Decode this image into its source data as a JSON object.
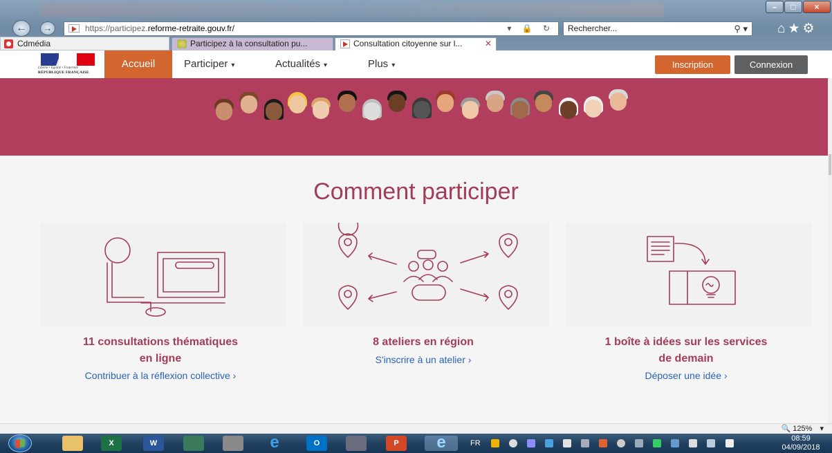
{
  "browser": {
    "url_scheme": "https://",
    "url_sub": "participez.",
    "url_domain": "reforme-retraite.gouv.fr",
    "url_path": "/",
    "search_placeholder": "Rechercher...",
    "favorites_label": "Cdmédia",
    "tabs": [
      {
        "label": "Participez à la consultation pu...",
        "active": false
      },
      {
        "label": "Consultation citoyenne sur l...",
        "active": true
      }
    ],
    "status_zoom": "🔍 125%",
    "zoom_caret": "▾"
  },
  "site": {
    "logo": {
      "devise": "Liberté • Égalité • Fraternité",
      "name": "RÉPUBLIQUE FRANÇAISE"
    },
    "nav": [
      {
        "label": "Accueil",
        "active": true
      },
      {
        "label": "Participer",
        "dropdown": true
      },
      {
        "label": "Actualités",
        "dropdown": true
      },
      {
        "label": "Plus",
        "dropdown": true
      }
    ],
    "btn_inscription": "Inscription",
    "btn_connexion": "Connexion",
    "accent": "#d3652e",
    "brand": "#b03e5c"
  },
  "main": {
    "title": "Comment participer",
    "columns": [
      {
        "title_line1": "11 consultations thématiques",
        "title_line2": "en ligne",
        "link": "Contribuer à la réflexion collective ›",
        "icon": "person-at-computer-icon"
      },
      {
        "title_line1": "8 ateliers en région",
        "title_line2": "",
        "link": "S'inscrire à un atelier ›",
        "icon": "regional-workshop-icon"
      },
      {
        "title_line1": "1 boîte à idées sur les services",
        "title_line2": "de demain",
        "link": "Déposer une idée ›",
        "icon": "idea-box-icon"
      }
    ]
  },
  "taskbar": {
    "lang": "FR",
    "time": "08:59",
    "date": "04/09/2018"
  }
}
